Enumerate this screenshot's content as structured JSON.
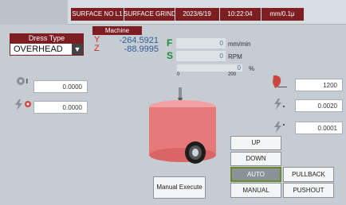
{
  "header": {
    "segments": [
      "SURFACE NO L1",
      "SURFACE GRIND",
      "2023/6/19",
      "10:22:04",
      "mm/0.1μ"
    ]
  },
  "dress": {
    "title": "Dress Type",
    "value": "OVERHEAD",
    "arrow": "▼"
  },
  "machine": {
    "title": "Machine",
    "y_label": "Y",
    "y_value": "-264.5921",
    "z_label": "Z",
    "z_value": "-88.9995"
  },
  "feed": {
    "f_label": "F",
    "f_value": "0",
    "f_unit": "mm/min",
    "s_label": "S",
    "s_value": "0",
    "s_unit": "RPM",
    "bar_value": "0",
    "bar_unit": "%",
    "scale_min": "0",
    "scale_max": "200",
    "bar_fraction": 0
  },
  "left_params": {
    "p1_value": "0.0000",
    "p2_value": "0.0000"
  },
  "right_params": {
    "p1_value": "1200",
    "p2_value": "0.0020",
    "p3_value": "0.0001"
  },
  "buttons": {
    "up": "UP",
    "down": "DOWN",
    "auto": "AUTO",
    "pullback": "PULLBACK",
    "manual": "MANUAL",
    "pushout": "PUSHOUT",
    "manual_execute": "Manual Execute"
  },
  "colors": {
    "accent": "#7d1f22",
    "wheel": "#e8797a",
    "background": "#c5cdd3",
    "auto_active": "#8a9498"
  }
}
